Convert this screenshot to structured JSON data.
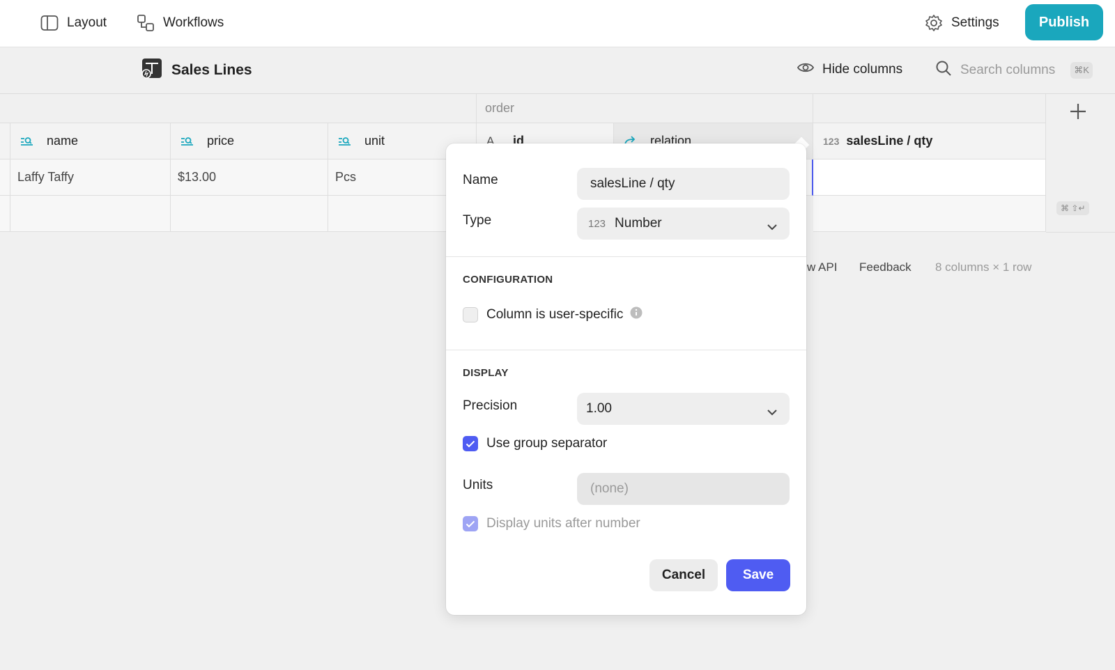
{
  "topbar": {
    "layout_label": "Layout",
    "workflows_label": "Workflows",
    "settings_label": "Settings",
    "publish_label": "Publish"
  },
  "subheader": {
    "table_title": "Sales Lines",
    "hide_columns_label": "Hide columns",
    "search_placeholder": "Search columns",
    "search_shortcut": "⌘K"
  },
  "grid": {
    "group_label": "order",
    "columns": [
      {
        "label": "name",
        "icon": "lookup-icon"
      },
      {
        "label": "price",
        "icon": "lookup-icon"
      },
      {
        "label": "unit",
        "icon": "lookup-icon"
      },
      {
        "label": "id",
        "icon": "text-icon",
        "type_glyph": "A"
      },
      {
        "label": "relation",
        "icon": "relation-icon"
      },
      {
        "label": "salesLine / qty",
        "icon": "number-icon",
        "type_glyph": "123"
      }
    ],
    "rows": [
      {
        "name": "Laffy Taffy",
        "price": "$13.00",
        "unit": "Pcs"
      }
    ],
    "add_row_shortcut": "⌘ ⇧↵"
  },
  "footer": {
    "api_label": "w API",
    "feedback_label": "Feedback",
    "summary": "8 columns × 1 row"
  },
  "dialog": {
    "name_label": "Name",
    "name_value": "salesLine / qty",
    "type_label": "Type",
    "type_glyph": "123",
    "type_value": "Number",
    "configuration_title": "CONFIGURATION",
    "user_specific_label": "Column is user-specific",
    "user_specific_checked": false,
    "display_title": "DISPLAY",
    "precision_label": "Precision",
    "precision_value": "1.00",
    "group_separator_label": "Use group separator",
    "group_separator_checked": true,
    "units_label": "Units",
    "units_placeholder": "(none)",
    "display_units_label": "Display units after number",
    "display_units_checked": true,
    "cancel_label": "Cancel",
    "save_label": "Save"
  },
  "colors": {
    "publish": "#1aa7bd",
    "accent": "#4f5cf2",
    "icon_teal": "#1aa7bd"
  }
}
